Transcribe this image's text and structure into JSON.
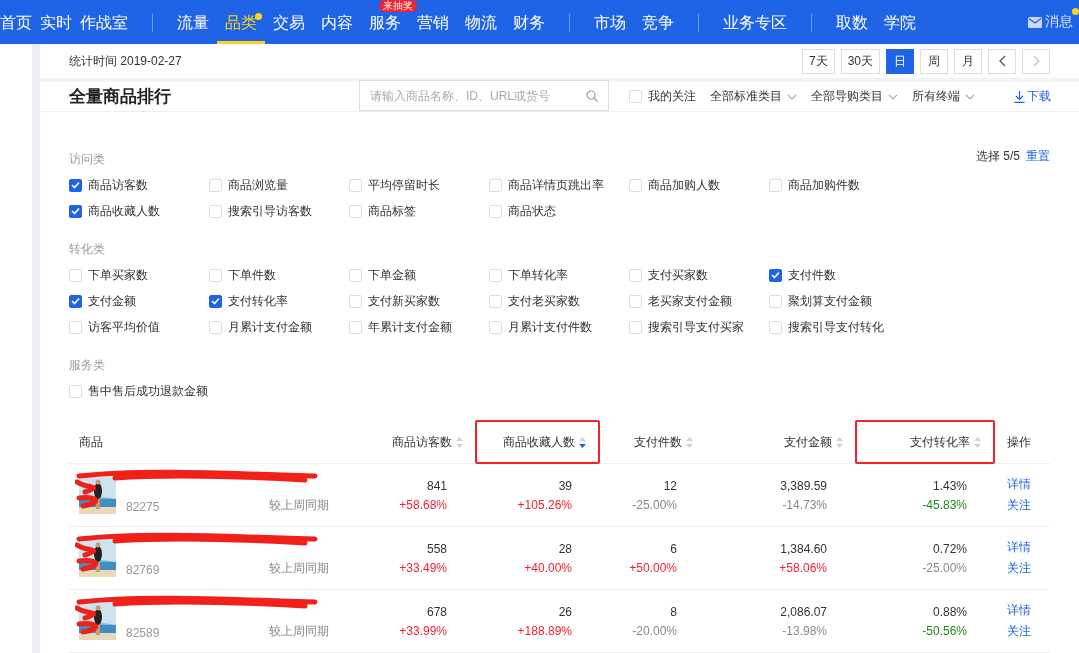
{
  "nav": {
    "groups": [
      [
        {
          "label": "首页",
          "selected": false,
          "dot": false
        },
        {
          "label": "实时",
          "selected": false,
          "dot": false
        },
        {
          "label": "作战室",
          "selected": false,
          "dot": false
        }
      ],
      [
        {
          "label": "流量",
          "selected": false,
          "dot": false
        },
        {
          "label": "品类",
          "selected": true,
          "dot": true
        },
        {
          "label": "交易",
          "selected": false,
          "dot": false
        },
        {
          "label": "内容",
          "selected": false,
          "dot": false
        },
        {
          "label": "服务",
          "selected": false,
          "dot": false,
          "badge": "来抽奖"
        },
        {
          "label": "营销",
          "selected": false,
          "dot": false
        },
        {
          "label": "物流",
          "selected": false,
          "dot": false
        },
        {
          "label": "财务",
          "selected": false,
          "dot": false
        }
      ],
      [
        {
          "label": "市场",
          "selected": false,
          "dot": false
        },
        {
          "label": "竞争",
          "selected": false,
          "dot": false
        }
      ],
      [
        {
          "label": "业务专区",
          "selected": false,
          "dot": false
        }
      ],
      [
        {
          "label": "取数",
          "selected": false,
          "dot": false
        },
        {
          "label": "学院",
          "selected": false,
          "dot": false
        }
      ]
    ],
    "messages": {
      "label": "消息",
      "dot": true
    }
  },
  "date_bar": {
    "label": "统计时间",
    "date": "2019-02-27",
    "periods": [
      {
        "label": "7天",
        "selected": false
      },
      {
        "label": "30天",
        "selected": false
      },
      {
        "label": "日",
        "selected": true
      },
      {
        "label": "周",
        "selected": false
      },
      {
        "label": "月",
        "selected": false
      }
    ],
    "prev": {
      "disabled": false
    },
    "next": {
      "disabled": true
    }
  },
  "toolbar": {
    "title": "全量商品排行",
    "search": {
      "placeholder": "请输入商品名称、ID、URL或货号"
    },
    "follow": {
      "label": "我的关注",
      "checked": false
    },
    "dropdowns": [
      "全部标准类目",
      "全部导购类目",
      "所有终端"
    ],
    "download": "下载"
  },
  "metrics": {
    "selection": "选择 5/5",
    "reset": "重置",
    "groups": [
      {
        "title": "访问类",
        "options": [
          {
            "label": "商品访客数",
            "checked": true
          },
          {
            "label": "商品浏览量",
            "checked": false
          },
          {
            "label": "平均停留时长",
            "checked": false
          },
          {
            "label": "商品详情页跳出率",
            "checked": false
          },
          {
            "label": "商品加购人数",
            "checked": false
          },
          {
            "label": "商品加购件数",
            "checked": false
          },
          {
            "label": "商品收藏人数",
            "checked": true
          },
          {
            "label": "搜索引导访客数",
            "checked": false
          },
          {
            "label": "商品标签",
            "checked": false
          },
          {
            "label": "商品状态",
            "checked": false
          }
        ]
      },
      {
        "title": "转化类",
        "options": [
          {
            "label": "下单买家数",
            "checked": false
          },
          {
            "label": "下单件数",
            "checked": false
          },
          {
            "label": "下单金额",
            "checked": false
          },
          {
            "label": "下单转化率",
            "checked": false
          },
          {
            "label": "支付买家数",
            "checked": false
          },
          {
            "label": "支付件数",
            "checked": true
          },
          {
            "label": "支付金额",
            "checked": true
          },
          {
            "label": "支付转化率",
            "checked": true
          },
          {
            "label": "支付新买家数",
            "checked": false
          },
          {
            "label": "支付老买家数",
            "checked": false
          },
          {
            "label": "老买家支付金额",
            "checked": false
          },
          {
            "label": "聚划算支付金额",
            "checked": false
          },
          {
            "label": "访客平均价值",
            "checked": false
          },
          {
            "label": "月累计支付金额",
            "checked": false
          },
          {
            "label": "年累计支付金额",
            "checked": false
          },
          {
            "label": "月累计支付件数",
            "checked": false
          },
          {
            "label": "搜索引导支付买家",
            "checked": false
          },
          {
            "label": "搜索引导支付转化",
            "checked": false
          }
        ]
      },
      {
        "title": "服务类",
        "options": [
          {
            "label": "售中售后成功退款金额",
            "checked": false
          }
        ]
      }
    ]
  },
  "table": {
    "columns": [
      {
        "label": "商品",
        "sortable": false,
        "highlighted": false
      },
      {
        "label": "商品访客数",
        "sortable": true,
        "sorted": false,
        "highlighted": false
      },
      {
        "label": "商品收藏人数",
        "sortable": true,
        "sorted": true,
        "highlighted": true
      },
      {
        "label": "支付件数",
        "sortable": true,
        "sorted": false,
        "highlighted": false
      },
      {
        "label": "支付金额",
        "sortable": true,
        "sorted": false,
        "highlighted": false
      },
      {
        "label": "支付转化率",
        "sortable": true,
        "sorted": false,
        "highlighted": true
      },
      {
        "label": "操作",
        "sortable": false,
        "highlighted": false
      }
    ],
    "rows": [
      {
        "cells": [
          {
            "kind": "product",
            "id": "82275",
            "compare": "较上周同期"
          },
          {
            "kind": "metric",
            "value": "841",
            "change": "+58.68%",
            "color": "#f5222d"
          },
          {
            "kind": "metric",
            "value": "39",
            "change": "+105.26%",
            "color": "#f5222d"
          },
          {
            "kind": "metric",
            "value": "12",
            "change": "-25.00%",
            "color": "#888888"
          },
          {
            "kind": "metric",
            "value": "3,389.59",
            "change": "-14.73%",
            "color": "#888888"
          },
          {
            "kind": "metric",
            "value": "1.43%",
            "change": "-45.83%",
            "color": "#1a8a1a"
          },
          {
            "kind": "actions",
            "actions": [
              "详情",
              "关注"
            ]
          }
        ]
      },
      {
        "cells": [
          {
            "kind": "product",
            "id": "82769",
            "compare": "较上周同期"
          },
          {
            "kind": "metric",
            "value": "558",
            "change": "+33.49%",
            "color": "#f5222d"
          },
          {
            "kind": "metric",
            "value": "28",
            "change": "+40.00%",
            "color": "#f5222d"
          },
          {
            "kind": "metric",
            "value": "6",
            "change": "+50.00%",
            "color": "#f5222d"
          },
          {
            "kind": "metric",
            "value": "1,384.60",
            "change": "+58.06%",
            "color": "#f5222d"
          },
          {
            "kind": "metric",
            "value": "0.72%",
            "change": "-25.00%",
            "color": "#888888"
          },
          {
            "kind": "actions",
            "actions": [
              "详情",
              "关注"
            ]
          }
        ]
      },
      {
        "cells": [
          {
            "kind": "product",
            "id": "82589",
            "compare": "较上周同期"
          },
          {
            "kind": "metric",
            "value": "678",
            "change": "+33.99%",
            "color": "#f5222d"
          },
          {
            "kind": "metric",
            "value": "26",
            "change": "+188.89%",
            "color": "#f5222d"
          },
          {
            "kind": "metric",
            "value": "8",
            "change": "-20.00%",
            "color": "#888888"
          },
          {
            "kind": "metric",
            "value": "2,086.07",
            "change": "-13.98%",
            "color": "#888888"
          },
          {
            "kind": "metric",
            "value": "0.88%",
            "change": "-50.56%",
            "color": "#1a8a1a"
          },
          {
            "kind": "actions",
            "actions": [
              "详情",
              "关注"
            ]
          }
        ]
      }
    ]
  }
}
